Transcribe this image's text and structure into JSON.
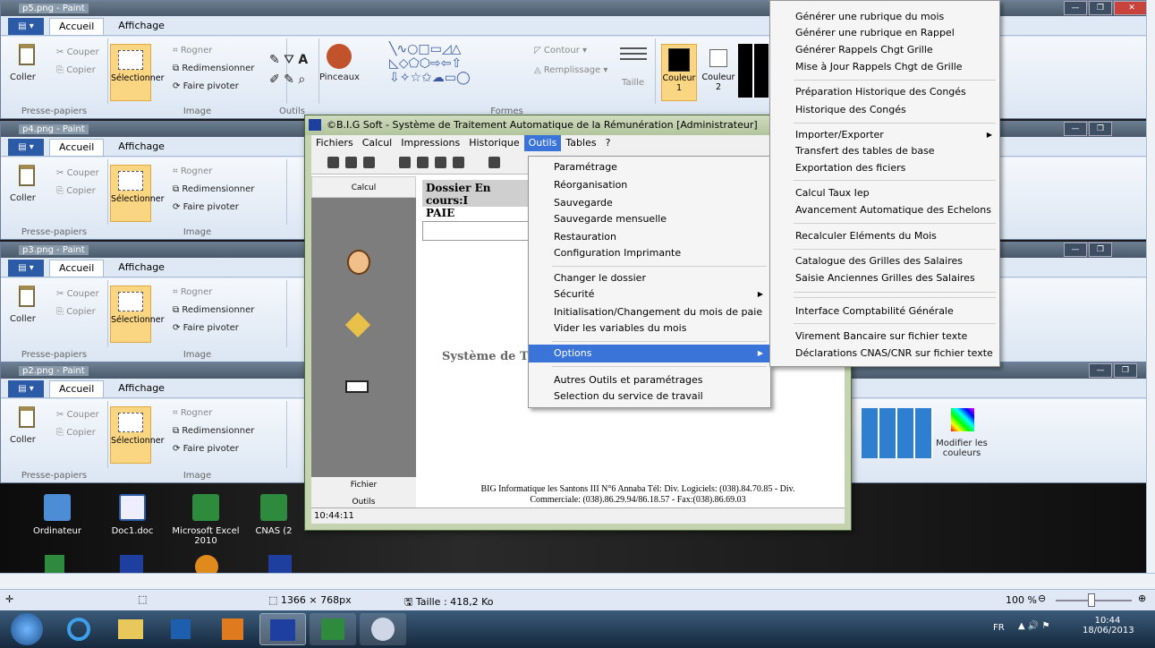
{
  "paint_windows": [
    {
      "title": "p5.png - Paint"
    },
    {
      "title": "p4.png - Paint"
    },
    {
      "title": "p3.png - Paint"
    },
    {
      "title": "p2.png - Paint"
    }
  ],
  "ribbon": {
    "tab_home": "Accueil",
    "tab_view": "Affichage",
    "coller": "Coller",
    "couper": "Couper",
    "copier": "Copier",
    "selectionner": "Sélectionner",
    "rogner": "Rogner",
    "redimensionner": "Redimensionner",
    "faire_pivoter": "Faire pivoter",
    "presse_papiers": "Presse-papiers",
    "image": "Image",
    "outils": "Outils",
    "pinceaux": "Pinceaux",
    "formes": "Formes",
    "contour": "Contour",
    "remplissage": "Remplissage",
    "taille": "Taille",
    "couleur1": "Couleur 1",
    "couleur2": "Couleur 2",
    "modifier_couleurs": "Modifier les couleurs"
  },
  "app": {
    "title": "©B.I.G Soft - Système de Traitement Automatique de la Rémunération  [Administrateur]",
    "menu": [
      "Fichiers",
      "Calcul",
      "Impressions",
      "Historique",
      "Outils",
      "Tables",
      "?"
    ],
    "left_head": "Calcul",
    "left_footer": [
      "Fichier",
      "Outils"
    ],
    "dossier": "Dossier En cours:I",
    "paie": "PAIE",
    "systeme": "Système de T",
    "footer_line1": "BIG Informatique les Santons III N°6 Annaba Tél: Div. Logiciels: (038).84.70.85 - Div.",
    "footer_line2": "Commerciale: (038).86.29.94/86.18.57 - Fax:(038).86.69.03",
    "clock": "10:44:11"
  },
  "outils_menu": [
    "Paramétrage",
    "Réorganisation",
    "Sauvegarde",
    "Sauvegarde mensuelle",
    "Restauration",
    "Configuration Imprimante",
    "Changer le dossier",
    "Sécurité",
    "Initialisation/Changement du mois de paie",
    "Vider les variables du mois",
    "Options",
    "Autres Outils et paramétrages",
    "Selection du service de travail"
  ],
  "options_menu": [
    "Générer une rubrique du mois",
    "Générer une rubrique en Rappel",
    "Générer Rappels Chgt Grille",
    "Mise à Jour Rappels Chgt de Grille",
    "Préparation Historique des Congés",
    "Historique des Congés",
    "Importer/Exporter",
    "Transfert des tables de base",
    "Exportation des ficiers",
    "Calcul Taux Iep",
    "Avancement Automatique des Echelons",
    "Recalculer Eléments du Mois",
    "Catalogue des Grilles des Salaires",
    "Saisie Anciennes Grilles des Salaires",
    "Interface Comptabilité Générale",
    "Virement Bancaire sur fichier texte",
    "Déclarations CNAS/CNR sur fichier texte"
  ],
  "desktop_icons": [
    {
      "label": "Ordinateur"
    },
    {
      "label": "Doc1.doc"
    },
    {
      "label": "Microsoft Excel 2010"
    },
    {
      "label": "CNAS (2"
    }
  ],
  "paint_status": {
    "dimensions": "1366 × 768px",
    "size": "Taille : 418,2 Ko",
    "zoom": "100 %"
  },
  "tray": {
    "lang": "FR",
    "time": "10:44",
    "date": "18/06/2013"
  }
}
